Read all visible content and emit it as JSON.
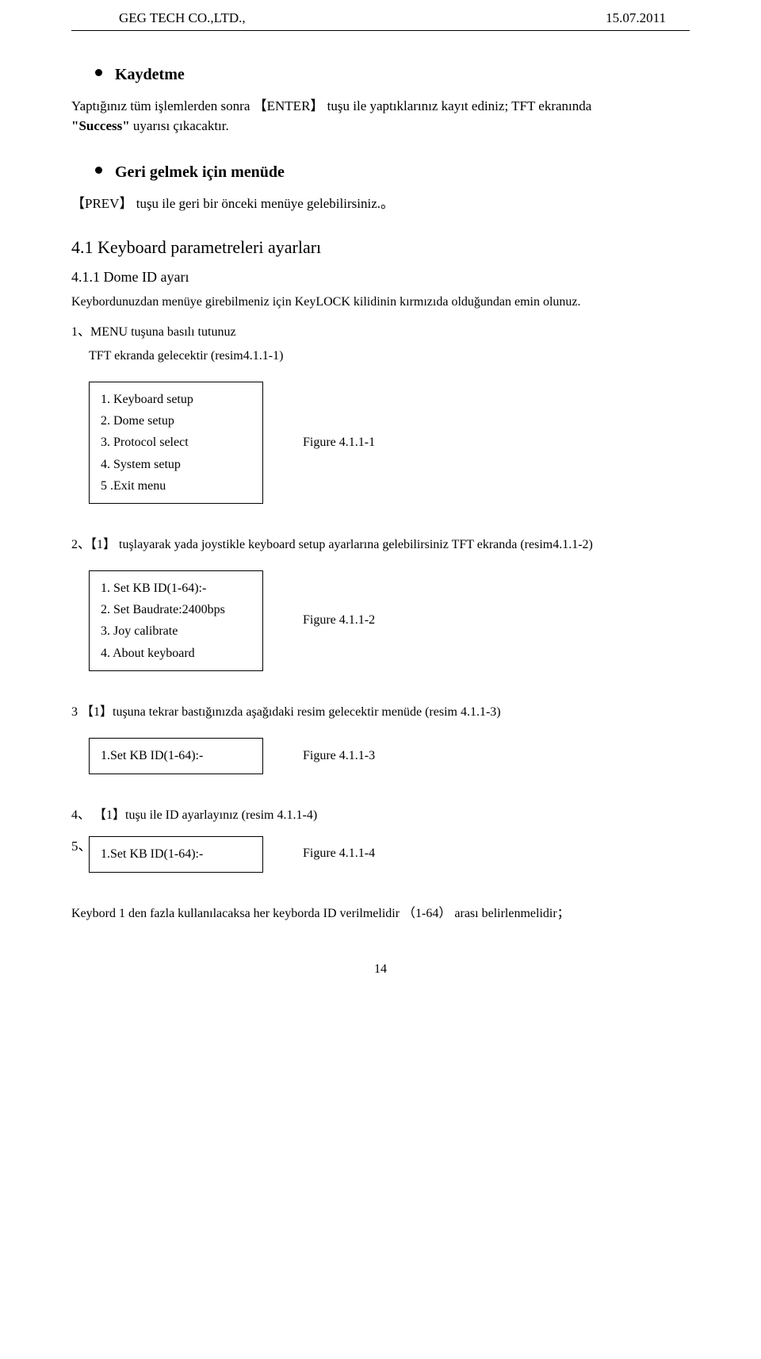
{
  "header": {
    "company": "GEG TECH CO.,LTD.,",
    "date": "15.07.2011"
  },
  "section1": {
    "title": "Kaydetme",
    "line1a": "Yaptığınız tüm işlemlerden sonra ",
    "line1b": "【ENTER】",
    "line1c": "tuşu ile yaptıklarınız kayıt ediniz; TFT ekranında",
    "line2a": "\"Success\"",
    "line2b": " uyarısı çıkacaktır."
  },
  "section2": {
    "title": "Geri gelmek için menüde",
    "line1a": "【PREV】",
    "line1b": "tuşu ile geri bir önceki menüye gelebilirsiniz.。"
  },
  "h41": "4.1 Keyboard parametreleri ayarları",
  "h411": "4.1.1 Dome ID ayarı",
  "h411_body": "Keybordunuzdan menüye girebilmeniz için KeyLOCK kilidinin kırmızıda olduğundan emin olunuz.",
  "step1_title": "1、MENU tuşuna basılı tutunuz",
  "step1_sub": "TFT ekranda    gelecektir (resim4.1.1-1)",
  "box1": {
    "l1": "1. Keyboard setup",
    "l2": "2. Dome setup",
    "l3": "3. Protocol select",
    "l4": "4. System setup",
    "l5": "5 .Exit menu"
  },
  "fig1": "Figure 4.1.1-1",
  "step2": "2、【1】 tuşlayarak yada joystikle    keyboard setup ayarlarına gelebilirsiniz    TFT ekranda (resim4.1.1-2)",
  "box2": {
    "l1": "1.   Set KB ID(1-64):-",
    "l2": "2.   Set Baudrate:2400bps",
    "l3": "3.   Joy calibrate",
    "l4": "4.   About keyboard"
  },
  "fig2": "Figure 4.1.1-2",
  "step3": "3  【1】tuşuna tekrar bastığınızda    aşağıdaki resim gelecektir menüde (resim 4.1.1-3)",
  "box3": {
    "l1": "1.Set KB ID(1-64):-"
  },
  "fig3": "Figure 4.1.1-3",
  "step4": "4、 【1】tuşu ile ID ayarlayınız (resim 4.1.1-4)",
  "step5_label": "5、",
  "box4": {
    "l1": "1.Set KB ID(1-64):-"
  },
  "fig4": "Figure 4.1.1-4",
  "footnote": "Keybord 1 den fazla kullanılacaksa her keyborda   ID verilmelidir （1-64） arası belirlenmelidir；",
  "page": "14"
}
